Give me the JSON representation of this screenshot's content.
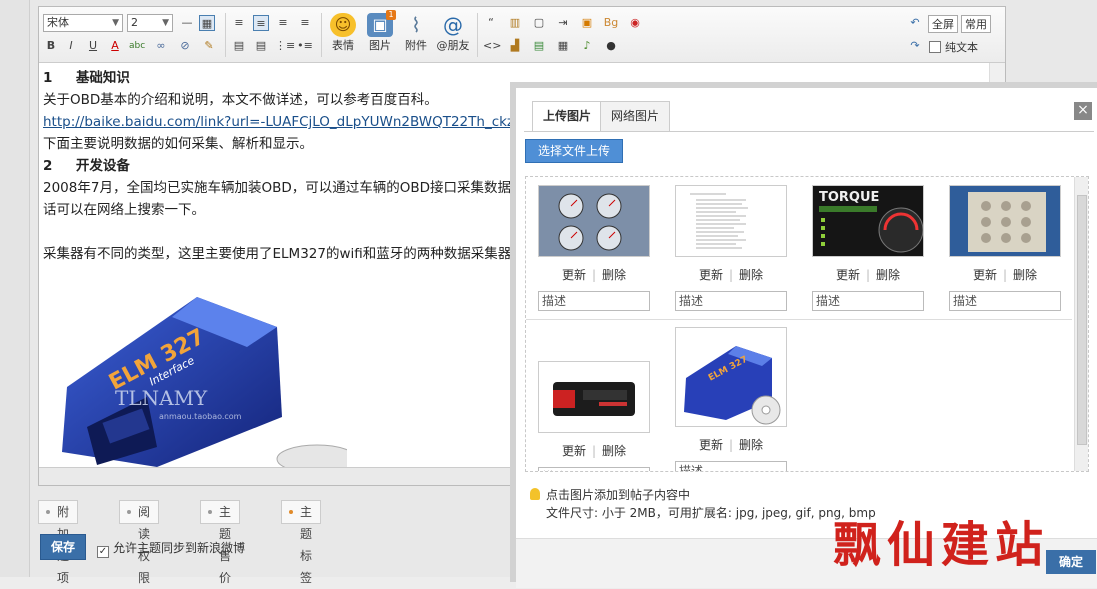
{
  "toolbar": {
    "font_name": "宋体",
    "font_size": "2",
    "emoji_label": "表情",
    "image_label": "图片",
    "attach_label": "附件",
    "mention_label": "@朋友",
    "fullscreen_label": "全屏",
    "common_label": "常用",
    "plaintext_label": "纯文本",
    "format_buttons": [
      "B",
      "I",
      "U",
      "A"
    ],
    "image_badge": "1"
  },
  "content": {
    "h1_num": "1",
    "h1_title": "基础知识",
    "p1": "关于OBD基本的介绍和说明，本文不做详述，可以参考百度百科。",
    "link": "http://baike.baidu.com/link?url=-LUAFCjLO_dLpYUWn2BWQT22Th_ckz",
    "p2": "下面主要说明数据的如何采集、解析和显示。",
    "h2_num": "2",
    "h2_title": "开发设备",
    "p3": "2008年7月，全国均已实施车辆加装OBD，可以通过车辆的OBD接口采集数据",
    "p4": "话可以在网络上搜索一下。",
    "p5": "采集器有不同的类型，这里主要使用了ELM327的wifi和蓝牙的两种数据采集器",
    "img_text1": "ELM 327",
    "img_text2": "Interface",
    "img_text3": "TLNAMY",
    "img_text4": "anmaou.taobao.com"
  },
  "options": [
    "附加选项",
    "阅读权限",
    "主题售价",
    "主题标签"
  ],
  "save_label": "保存",
  "sync_label": "允许主题同步到新浪微博",
  "dialog": {
    "close": "×",
    "tab_upload": "上传图片",
    "tab_network": "网络图片",
    "upload_button": "选择文件上传",
    "update_label": "更新",
    "delete_label": "删除",
    "desc_placeholder": "描述",
    "sep": "|",
    "torque_text": "TORQUE",
    "hint": "点击图片添加到帖子内容中",
    "file_info": "文件尺寸: 小于 2MB，可用扩展名: jpg, jpeg, gif, png, bmp",
    "confirm": "确定"
  },
  "watermark": "飘仙建站"
}
